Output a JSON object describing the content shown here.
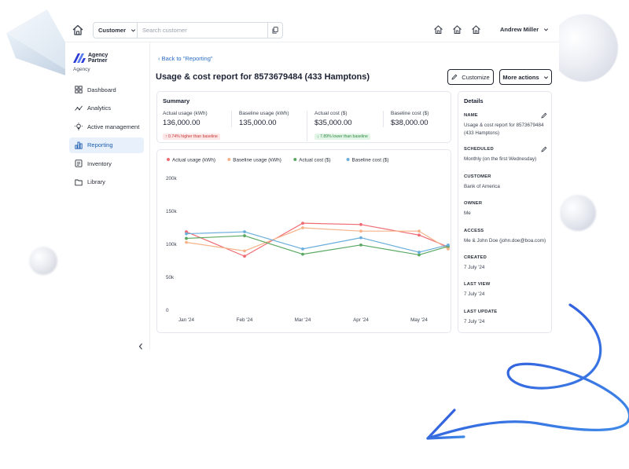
{
  "header": {
    "search_scope": "Customer",
    "search_placeholder": "Search customer",
    "user_name": "Andrew Miller"
  },
  "sidebar": {
    "brand_line1": "Agency",
    "brand_line2": "Partner",
    "brand_sub": "Agency",
    "items": [
      {
        "label": "Dashboard",
        "icon": "dashboard-icon"
      },
      {
        "label": "Analytics",
        "icon": "analytics-icon"
      },
      {
        "label": "Active management",
        "icon": "active-management-icon"
      },
      {
        "label": "Reporting",
        "icon": "reporting-icon",
        "active": true
      },
      {
        "label": "Inventory",
        "icon": "inventory-icon"
      },
      {
        "label": "Library",
        "icon": "library-icon"
      }
    ]
  },
  "main": {
    "back_link": "Back to \"Reporting\"",
    "title": "Usage & cost report for 8573679484 (433 Hamptons)",
    "customize_label": "Customize",
    "more_actions_label": "More actions"
  },
  "summary": {
    "title": "Summary",
    "metrics": [
      {
        "label": "Actual usage (kWh)",
        "value": "136,000.00",
        "badge": "↑ 0.74% higher than baseline",
        "badge_type": "red"
      },
      {
        "label": "Baseline usage (kWh)",
        "value": "135,000.00"
      },
      {
        "label": "Actual cost ($)",
        "value": "$35,000.00",
        "badge": "↓ 7.89% lower than baseline",
        "badge_type": "green"
      },
      {
        "label": "Baseline cost ($)",
        "value": "$38,000.00"
      }
    ]
  },
  "chart_data": {
    "type": "line",
    "categories": [
      "Jan '24",
      "Feb '24",
      "Mar '24",
      "Apr '24",
      "May '24"
    ],
    "x": [
      0,
      1,
      2,
      3,
      4,
      4.5
    ],
    "ylim": [
      0,
      200000
    ],
    "yticks": [
      0,
      50000,
      100000,
      150000,
      200000
    ],
    "ytick_labels": [
      "0",
      "50k",
      "100k",
      "150k",
      "200k"
    ],
    "legend_position": "top-left",
    "grid": false,
    "series": [
      {
        "name": "Actual usage (kWh)",
        "color": "#ef6b73",
        "values": [
          119000,
          82000,
          132000,
          130000,
          114000,
          96000
        ]
      },
      {
        "name": "Baseline usage (kWh)",
        "color": "#f5b38a",
        "values": [
          103000,
          90000,
          125000,
          120000,
          120000,
          93000
        ]
      },
      {
        "name": "Actual cost ($)",
        "color": "#5aa862",
        "values": [
          109000,
          113000,
          85000,
          99000,
          84000,
          97000
        ]
      },
      {
        "name": "Baseline cost ($)",
        "color": "#6aaedc",
        "values": [
          116000,
          119000,
          93000,
          110000,
          88000,
          99000
        ]
      }
    ]
  },
  "details": {
    "title": "Details",
    "fields": [
      {
        "label": "NAME",
        "value": "Usage & cost report for 8573679484 (433 Hamptons)",
        "editable": true
      },
      {
        "label": "SCHEDULED",
        "value": "Monthly (on the first Wednesday)",
        "editable": true
      },
      {
        "label": "CUSTOMER",
        "value": "Bank of America"
      },
      {
        "label": "OWNER",
        "value": "Me"
      },
      {
        "label": "ACCESS",
        "value": "Me & John Doe (john.doe@boa.com)"
      },
      {
        "label": "CREATED",
        "value": "7 July '24"
      },
      {
        "label": "LAST VIEW",
        "value": "7 July '24"
      },
      {
        "label": "LAST UPDATE",
        "value": "7 July '24"
      }
    ]
  },
  "colors": {
    "accent": "#2b6fc4",
    "nav_active_bg": "#e7f0fb",
    "border": "#e3e6ec"
  }
}
